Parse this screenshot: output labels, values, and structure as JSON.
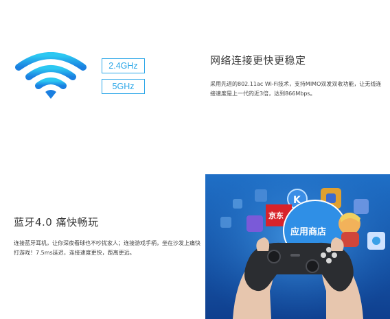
{
  "wifi": {
    "bands": [
      "2.4GHz",
      "5GHz"
    ],
    "title": "网络连接更快更稳定",
    "description": "采用先进的802.11ac Wi-Fi技术，支持MIMO双发双收功能，让无线连接速度是上一代的近3倍，达到866Mbps。",
    "icon": "wifi-icon",
    "colors": {
      "band_border": "#2aa6e8",
      "wifi_top": "#29c4f0",
      "wifi_bottom": "#1a7fe0"
    }
  },
  "bluetooth": {
    "title": "蓝牙4.0 痛快畅玩",
    "description": "连接蓝牙耳机，让你深夜看球也不吵扰家人；连接游戏手柄，坐在沙发上痛快打游戏！7.5ms延迟，连接速度更快，距离更远。"
  },
  "tv_screen": {
    "jd_tile": "京东",
    "app_store_label": "应用商店",
    "colors": {
      "screen_top": "#1f6fc6",
      "screen_bottom": "#0f3f8e",
      "app_store_bubble": "#2f8fe6",
      "jd_red": "#d8232a"
    }
  }
}
